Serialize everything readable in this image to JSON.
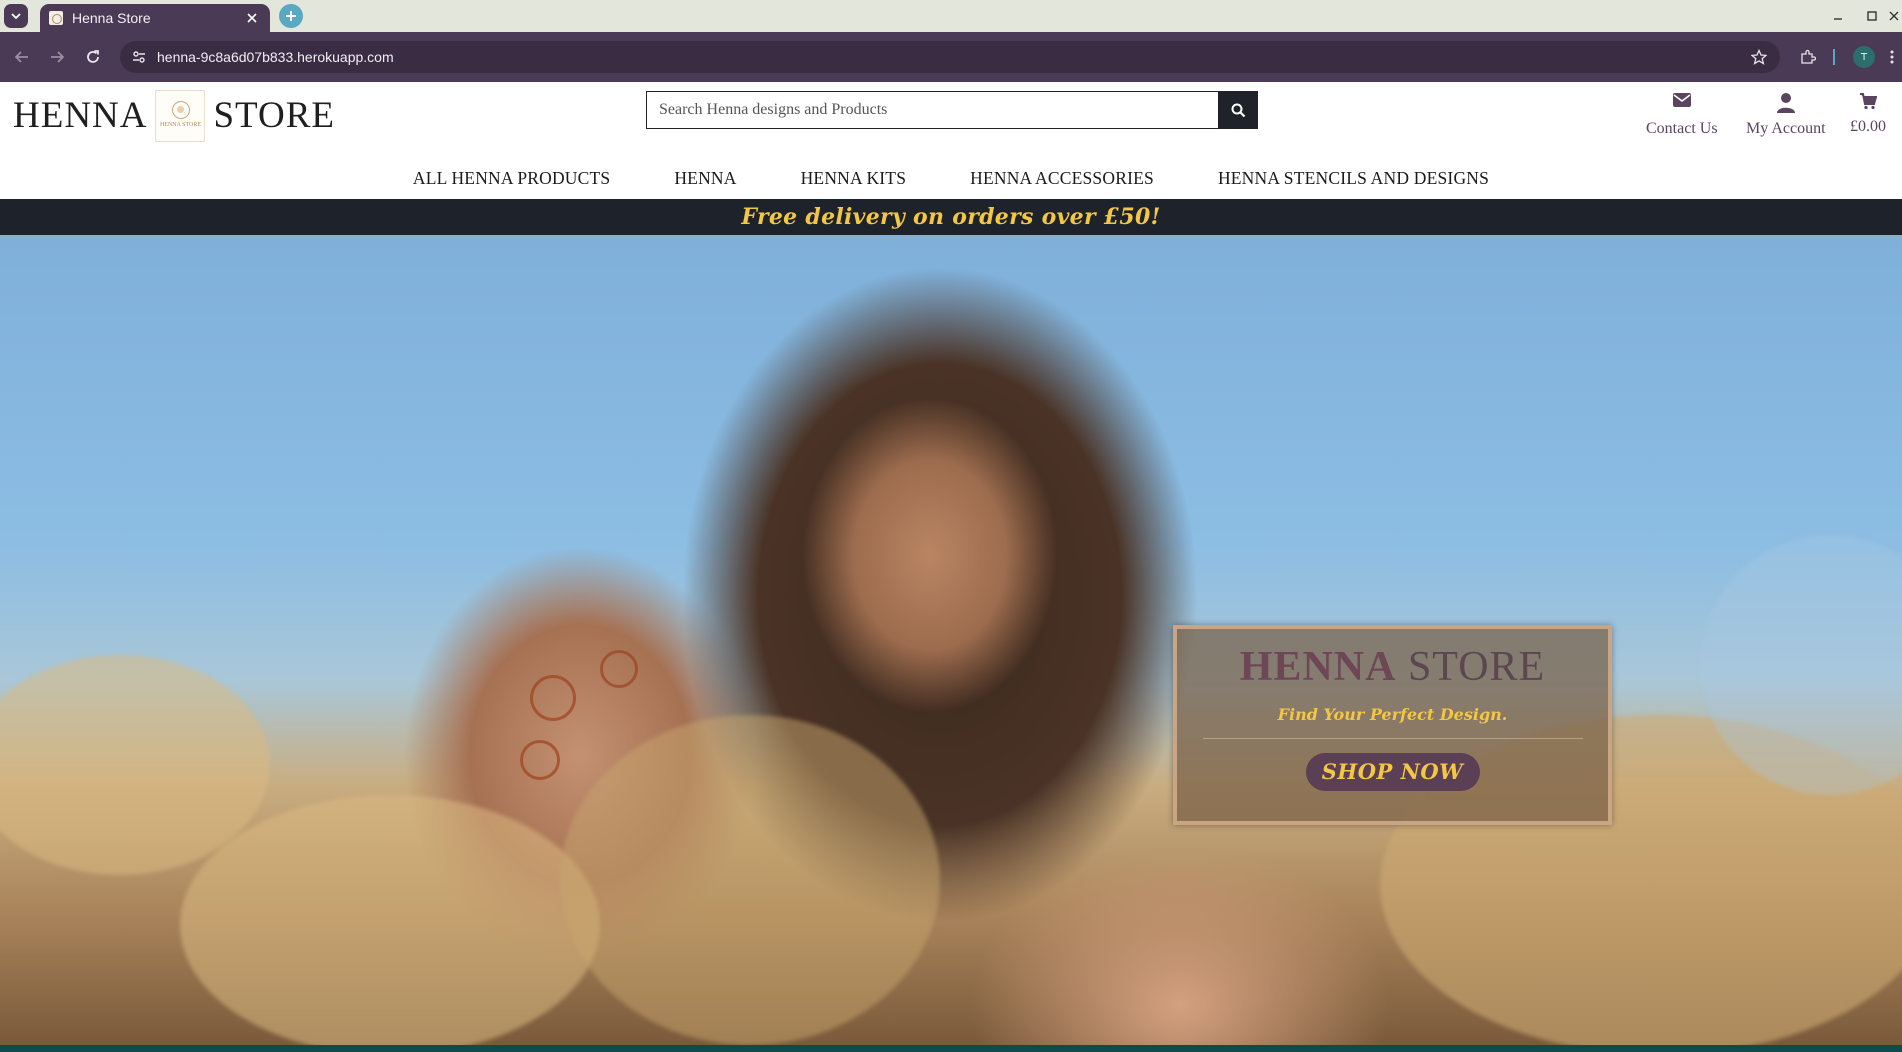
{
  "browser": {
    "tab_title": "Henna Store",
    "url": "henna-9c8a6d07b833.herokuapp.com",
    "profile_initial": "T"
  },
  "site": {
    "logo_left": "HENNA",
    "logo_right": "STORE",
    "logo_mark_text": "HENNA STORE",
    "search_placeholder": "Search Henna designs and Products",
    "contact_label": "Contact Us",
    "account_label": "My Account",
    "cart_total": "£0.00",
    "nav": [
      {
        "label": "ALL HENNA PRODUCTS"
      },
      {
        "label": "HENNA"
      },
      {
        "label": "HENNA KITS"
      },
      {
        "label": "HENNA ACCESSORIES"
      },
      {
        "label": "HENNA STENCILS AND DESIGNS"
      }
    ],
    "promo": "Free delivery on orders over £50!"
  },
  "hero": {
    "title_1": "HENNA",
    "title_2": "STORE",
    "tagline": "Find Your Perfect Design.",
    "cta": "SHOP NOW"
  },
  "colors": {
    "accent_gold": "#f3c744",
    "brand_plum": "#5b3f55",
    "chrome": "#4b3a55",
    "promo_bg": "#1e232b"
  }
}
